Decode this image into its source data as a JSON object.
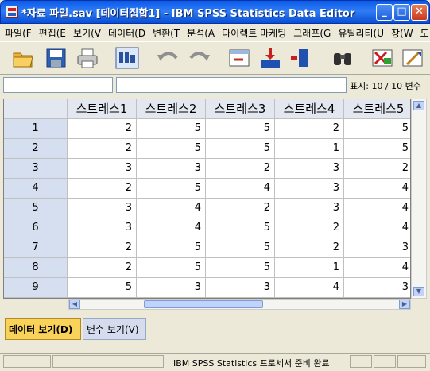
{
  "window": {
    "title": "*자료 파일.sav [데이터집합1] - IBM SPSS Statistics Data Editor"
  },
  "menu": [
    "파일(F",
    "편집(E",
    "보기(V",
    "데이터(D",
    "변환(T",
    "분석(A",
    "다이렉트 마케팅",
    "그래프(G",
    "유틸리티(U",
    "창(W",
    "도움말(H"
  ],
  "toolbar": {
    "icons": [
      "open-folder-icon",
      "save-icon",
      "print-icon",
      "dialog-recall-icon",
      "undo-icon",
      "redo-icon",
      "goto-case-icon",
      "insert-cases-icon",
      "insert-variable-icon",
      "find-icon",
      "split-file-icon",
      "weight-cases-icon"
    ]
  },
  "cellbar": {
    "variables_label": "표시: 10 / 10 변수"
  },
  "grid": {
    "columns": [
      "스트레스1",
      "스트레스2",
      "스트레스3",
      "스트레스4",
      "스트레스5"
    ],
    "rows": [
      {
        "label": "1",
        "values": [
          "2",
          "5",
          "5",
          "2",
          "5"
        ]
      },
      {
        "label": "2",
        "values": [
          "2",
          "5",
          "5",
          "1",
          "5"
        ]
      },
      {
        "label": "3",
        "values": [
          "3",
          "3",
          "2",
          "3",
          "2"
        ]
      },
      {
        "label": "4",
        "values": [
          "2",
          "5",
          "4",
          "3",
          "4"
        ]
      },
      {
        "label": "5",
        "values": [
          "3",
          "4",
          "2",
          "3",
          "4"
        ]
      },
      {
        "label": "6",
        "values": [
          "3",
          "4",
          "5",
          "2",
          "4"
        ]
      },
      {
        "label": "7",
        "values": [
          "2",
          "5",
          "5",
          "2",
          "3"
        ]
      },
      {
        "label": "8",
        "values": [
          "2",
          "5",
          "5",
          "1",
          "4"
        ]
      },
      {
        "label": "9",
        "values": [
          "5",
          "3",
          "3",
          "4",
          "3"
        ]
      }
    ]
  },
  "tabs": {
    "data_view": "데이터 보기(D)",
    "variable_view": "변수 보기(V)"
  },
  "status": {
    "text": "IBM SPSS Statistics 프로세서 준비 완료"
  },
  "colors": {
    "title_blue": "#0a5ae8",
    "active_tab": "#f9d25a",
    "header_bg": "#e3e8f0",
    "row_header_bg": "#d6dff0"
  }
}
